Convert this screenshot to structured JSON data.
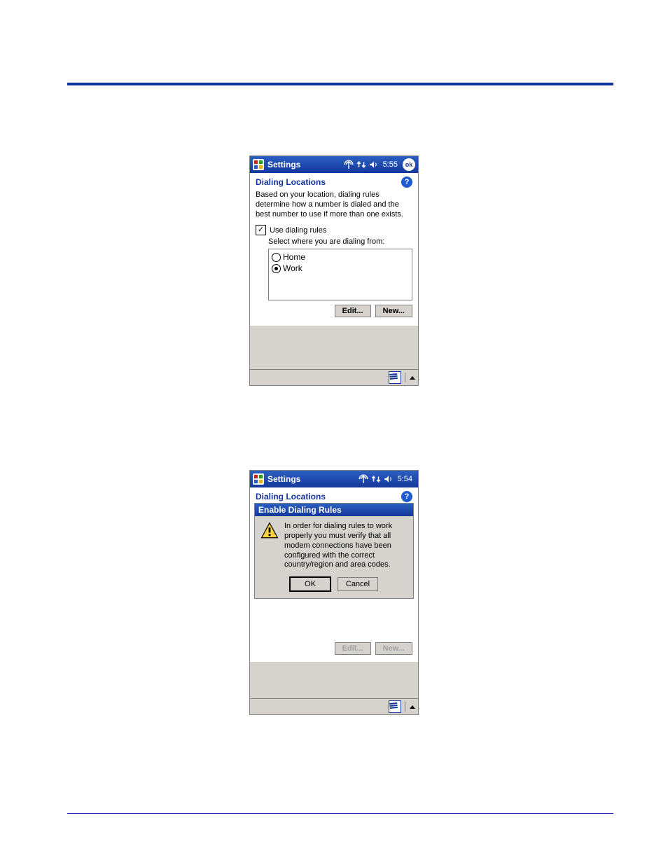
{
  "screenshot1": {
    "titlebar": {
      "app": "Settings",
      "time": "5:55",
      "ok": "ok"
    },
    "heading": "Dialing Locations",
    "description": "Based on your location, dialing rules determine how a number is dialed and the best number to use if more than one exists.",
    "checkbox": {
      "label": "Use dialing rules",
      "checked": true
    },
    "sublabel": "Select where you are dialing from:",
    "locations": [
      {
        "label": "Home",
        "selected": false
      },
      {
        "label": "Work",
        "selected": true
      }
    ],
    "buttons": {
      "edit": "Edit...",
      "new": "New..."
    }
  },
  "screenshot2": {
    "titlebar": {
      "app": "Settings",
      "time": "5:54"
    },
    "heading": "Dialing Locations",
    "dialog": {
      "title": "Enable Dialing Rules",
      "message": "In order for dialing rules to work properly you must verify that all modem connections have been configured with the correct country/region and area codes.",
      "ok": "OK",
      "cancel": "Cancel"
    },
    "buttons": {
      "edit": "Edit...",
      "new": "New..."
    }
  }
}
